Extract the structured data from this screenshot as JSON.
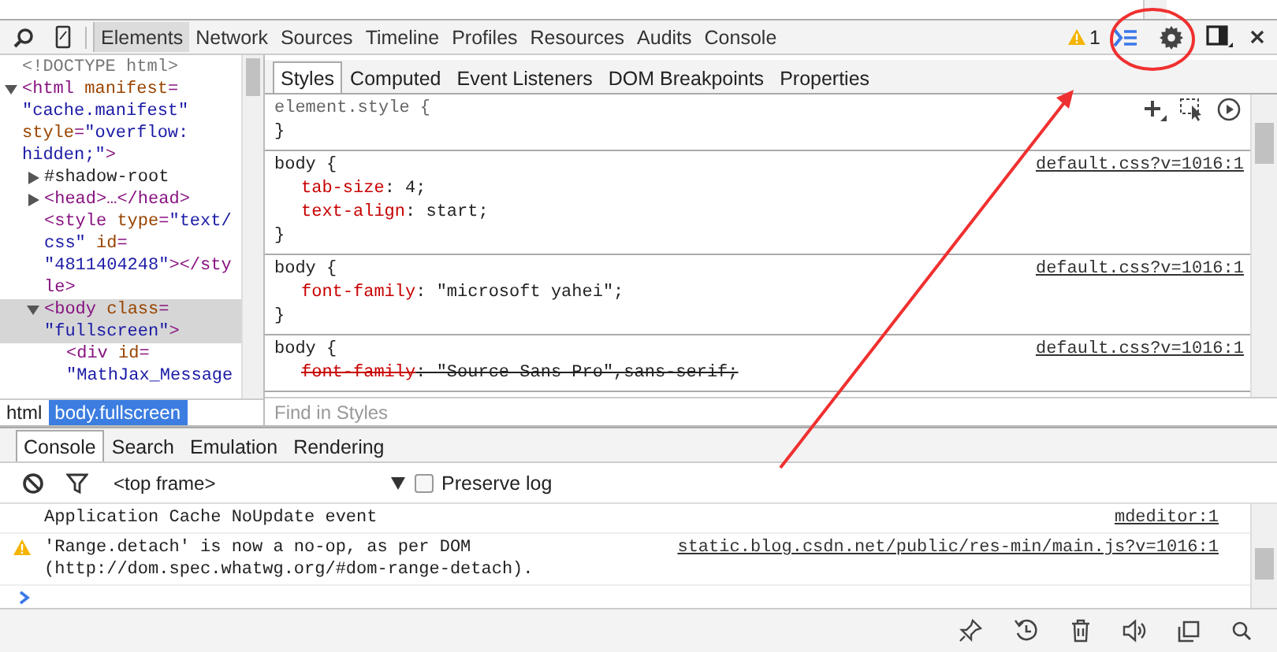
{
  "toolbar": {
    "tabs": [
      {
        "label": "Elements",
        "selected": true
      },
      {
        "label": "Network",
        "selected": false
      },
      {
        "label": "Sources",
        "selected": false
      },
      {
        "label": "Timeline",
        "selected": false
      },
      {
        "label": "Profiles",
        "selected": false
      },
      {
        "label": "Resources",
        "selected": false
      },
      {
        "label": "Audits",
        "selected": false
      },
      {
        "label": "Console",
        "selected": false
      }
    ],
    "warning_count": "1"
  },
  "elements": {
    "tree": [
      {
        "selected": false,
        "lines": [
          [
            {
              "kind": "doctype",
              "s": "<!DOCTYPE html>"
            }
          ]
        ]
      },
      {
        "expanded": true,
        "selected": false,
        "lines": [
          [
            {
              "kind": "tag",
              "s": "<html"
            },
            {
              "kind": "attr",
              "s": " manifest"
            },
            {
              "kind": "tag",
              "s": "="
            }
          ],
          [
            {
              "kind": "value",
              "s": "\"cache.manifest\""
            }
          ],
          [
            {
              "kind": "attr",
              "s": "style"
            },
            {
              "kind": "tag",
              "s": "="
            },
            {
              "kind": "value",
              "s": "\"overflow:"
            }
          ],
          [
            {
              "kind": "value",
              "s": "hidden;\""
            },
            {
              "kind": "tag",
              "s": ">"
            }
          ]
        ],
        "children": [
          {
            "expanded": false,
            "selected": false,
            "lines": [
              [
                {
                  "kind": "text",
                  "s": "#shadow-root"
                }
              ]
            ]
          },
          {
            "expanded": false,
            "selected": false,
            "lines": [
              [
                {
                  "kind": "tag",
                  "s": "<head>…</head>"
                }
              ]
            ]
          },
          {
            "selected": false,
            "lines": [
              [
                {
                  "kind": "tag",
                  "s": "<style"
                },
                {
                  "kind": "attr",
                  "s": " type"
                },
                {
                  "kind": "tag",
                  "s": "="
                },
                {
                  "kind": "value",
                  "s": "\"text/"
                }
              ],
              [
                {
                  "kind": "value",
                  "s": "css\""
                },
                {
                  "kind": "attr",
                  "s": " id"
                },
                {
                  "kind": "tag",
                  "s": "="
                }
              ],
              [
                {
                  "kind": "value",
                  "s": "\"4811404248\""
                },
                {
                  "kind": "tag",
                  "s": "></sty"
                }
              ],
              [
                {
                  "kind": "tag",
                  "s": "le>"
                }
              ]
            ]
          },
          {
            "expanded": true,
            "selected": true,
            "lines": [
              [
                {
                  "kind": "tag",
                  "s": "<body"
                },
                {
                  "kind": "attr",
                  "s": " class"
                },
                {
                  "kind": "tag",
                  "s": "="
                }
              ],
              [
                {
                  "kind": "value",
                  "s": "\"fullscreen\""
                },
                {
                  "kind": "tag",
                  "s": ">"
                }
              ]
            ],
            "children": [
              {
                "selected": false,
                "lines": [
                  [
                    {
                      "kind": "tag",
                      "s": "<div"
                    },
                    {
                      "kind": "attr",
                      "s": " id"
                    },
                    {
                      "kind": "tag",
                      "s": "="
                    }
                  ],
                  [
                    {
                      "kind": "value",
                      "s": "\"MathJax_Message"
                    }
                  ]
                ]
              }
            ]
          }
        ]
      }
    ],
    "breadcrumbs": [
      {
        "label": "html",
        "selected": false
      },
      {
        "label": "body.fullscreen",
        "selected": true
      }
    ]
  },
  "styles": {
    "tabs": [
      {
        "label": "Styles",
        "selected": true
      },
      {
        "label": "Computed",
        "selected": false
      },
      {
        "label": "Event Listeners",
        "selected": false
      },
      {
        "label": "DOM Breakpoints",
        "selected": false
      },
      {
        "label": "Properties",
        "selected": false
      }
    ],
    "rules": [
      {
        "kind": "inline",
        "selector": "element.style {",
        "close": "}"
      },
      {
        "kind": "rule",
        "selector": "body {",
        "source": "default.css?v=1016:1",
        "close": "}",
        "props": [
          {
            "name": "tab-size",
            "value": ": 4;",
            "struck": false
          },
          {
            "name": "text-align",
            "value": ": start;",
            "struck": false
          }
        ]
      },
      {
        "kind": "rule",
        "selector": "body {",
        "source": "default.css?v=1016:1",
        "close": "}",
        "props": [
          {
            "name": "font-family",
            "value": ": \"microsoft yahei\";",
            "struck": false
          }
        ]
      },
      {
        "kind": "rule",
        "selector": "body {",
        "source": "default.css?v=1016:1",
        "props": [
          {
            "name": "font-family",
            "value": ": \"Source Sans Pro\",sans-serif;",
            "struck": true
          }
        ]
      }
    ],
    "filter": {
      "placeholder": "Find in Styles"
    }
  },
  "drawer": {
    "tabs": [
      {
        "label": "Console",
        "selected": true
      },
      {
        "label": "Search",
        "selected": false
      },
      {
        "label": "Emulation",
        "selected": false
      },
      {
        "label": "Rendering",
        "selected": false
      }
    ],
    "context": "<top frame>",
    "preserve_log": {
      "label": "Preserve log",
      "checked": false
    },
    "messages": [
      {
        "kind": "log",
        "text": "Application Cache NoUpdate event",
        "source": "mdeditor:1"
      },
      {
        "kind": "warning",
        "text": "'Range.detach' is now a no-op, as per DOM\n(http://dom.spec.whatwg.org/#dom-range-detach).",
        "source": "static.blog.csdn.net/public/res-min/main.js?v=1016:1"
      }
    ]
  }
}
